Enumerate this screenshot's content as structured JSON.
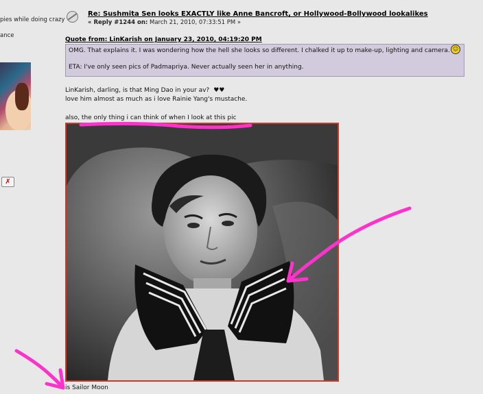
{
  "sidebar": {
    "text_line1": "pies while doing crazy",
    "text_line2": "ance",
    "button_glyph": "✗"
  },
  "post": {
    "title": "Re: Sushmita Sen looks EXACTLY like Anne Bancroft, or Hollywood-Bollywood lookalikes",
    "reply_prefix": "« Reply #1244 on:",
    "reply_date": "March 21, 2010, 07:33:51 PM »",
    "icon": "post-topic-icon"
  },
  "quote": {
    "header": "Quote from: LinKarish on January 23, 2010, 04:19:20 PM",
    "line1": "OMG. That explains it.  I was wondering how the hell she looks so different.  I chalked it up to make-up, lighting and camera.",
    "line2": "ETA: I've only seen pics of Padmapriya. Never actually seen her in anything.",
    "smiley": "grin-smiley-icon",
    "background_color": "#d2cbdd"
  },
  "body": {
    "line1": "LinKarish, darling, is that Ming Dao in your av?",
    "hearts": "♥♥",
    "line2": "love him almost as much as i love Rainie Yang's mustache.",
    "line3": "also, the only thing i can think of when I look at this pic",
    "line4": "is Sailor Moon"
  },
  "annotation_color": "#ff33cc",
  "photo_border_color": "#c83a2a"
}
